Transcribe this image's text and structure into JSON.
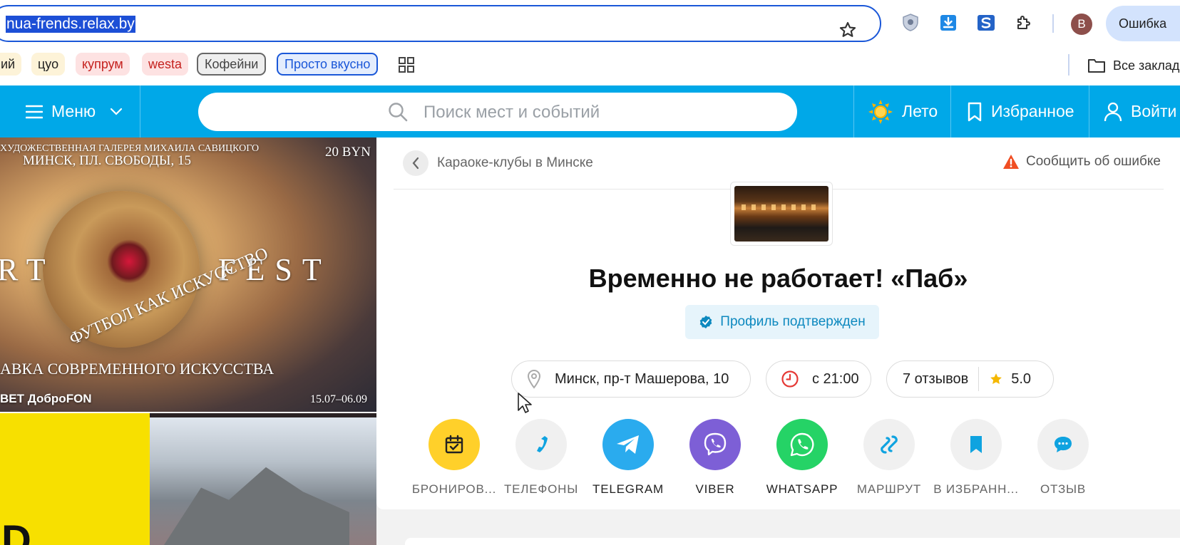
{
  "browser": {
    "url": "nua-frends.relax.by",
    "profile_initial": "B",
    "error_button": "Ошибка",
    "bookmarks": [
      {
        "label": "ий",
        "style": "yellow"
      },
      {
        "label": "цуо",
        "style": "yellow"
      },
      {
        "label": "купрум",
        "style": "red"
      },
      {
        "label": "westa",
        "style": "red"
      },
      {
        "label": "Кофейни",
        "style": "grey"
      },
      {
        "label": "Просто вкусно",
        "style": "blue"
      }
    ],
    "all_bookmarks": "Все заклад"
  },
  "header": {
    "menu_label": "Меню",
    "search_placeholder": "Поиск мест и событий",
    "season_label": "Лето",
    "favorites_label": "Избранное",
    "login_label": "Войти",
    "accent_color": "#00a8e8"
  },
  "banner": {
    "gallery": "ХУДОЖЕСТВЕННАЯ ГАЛЕРЕЯ МИХАИЛА САВИЦКОГО",
    "address": "МИНСК, ПЛ. СВОБОДЫ, 15",
    "price": "20 BYN",
    "art": "RT",
    "fest": "FEST",
    "football": "ФУТБОЛ КАК ИСКУССТВО",
    "exhibition": "АВКА СОВРЕМЕННОГО ИСКУССТВА",
    "sponsors": "BET   ДоброFON",
    "dates": "15.07–06.09",
    "banner2_letter": "D"
  },
  "place": {
    "breadcrumb": "Караоке-клубы в Минске",
    "report_error": "Сообщить об ошибке",
    "title": "Временно не работает! «Паб»",
    "verified": "Профиль подтвержден",
    "address": "Минск, пр-т Машерова, 10",
    "hours": "с 21:00",
    "reviews": "7 отзывов",
    "rating": "5.0"
  },
  "actions": [
    {
      "label": "БРОНИРОВ...",
      "icon": "calendar-check-icon",
      "color": "#ffd02a"
    },
    {
      "label": "ТЕЛЕФОНЫ",
      "icon": "phone-icon",
      "color": "#f0f0f0"
    },
    {
      "label": "TELEGRAM",
      "icon": "telegram-icon",
      "color": "#2aabee"
    },
    {
      "label": "VIBER",
      "icon": "viber-icon",
      "color": "#7d5fd6"
    },
    {
      "label": "WHATSAPP",
      "icon": "whatsapp-icon",
      "color": "#25d366"
    },
    {
      "label": "МАРШРУТ",
      "icon": "route-icon",
      "color": "#f0f0f0"
    },
    {
      "label": "В ИЗБРАНН...",
      "icon": "bookmark-icon",
      "color": "#f0f0f0"
    },
    {
      "label": "ОТЗЫВ",
      "icon": "comment-icon",
      "color": "#f0f0f0"
    }
  ]
}
